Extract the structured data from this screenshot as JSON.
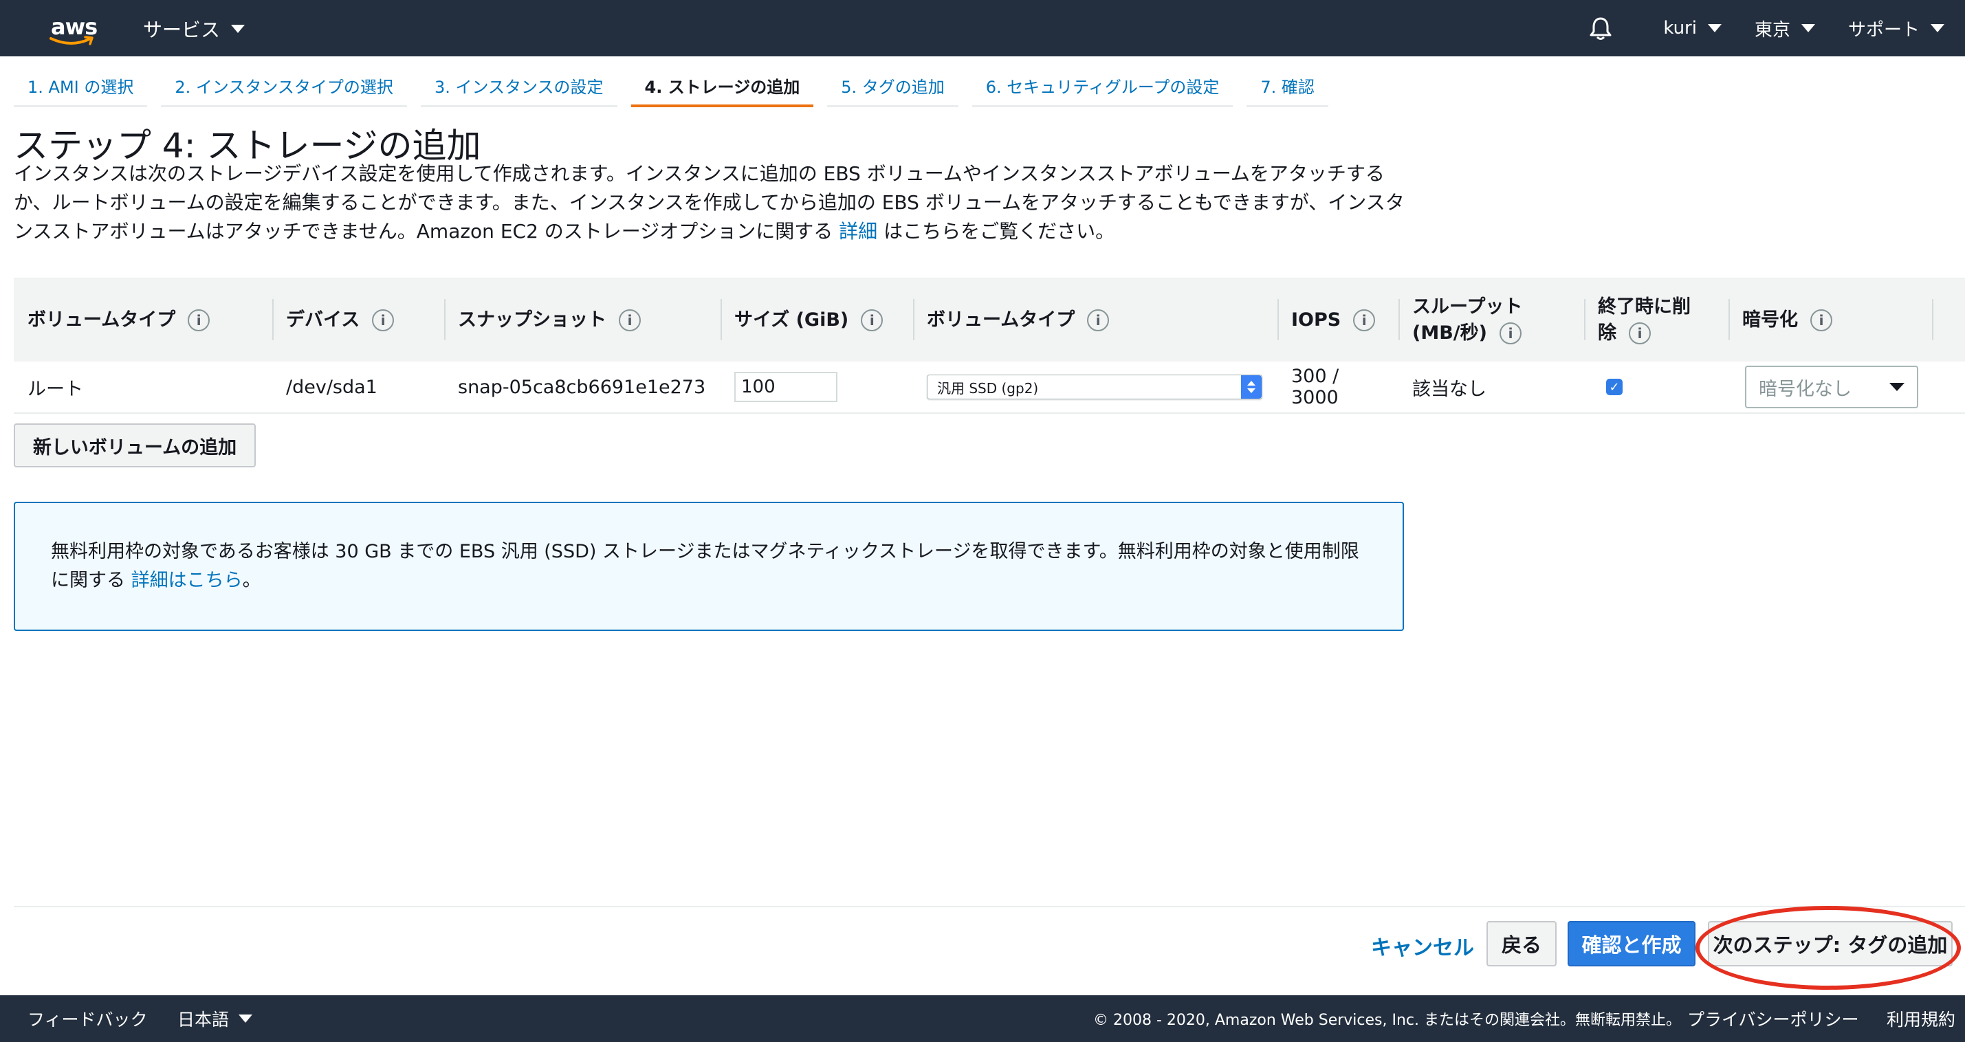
{
  "header": {
    "logo_text": "aws",
    "services_label": "サービス",
    "user_label": "kuri",
    "region_label": "東京",
    "support_label": "サポート"
  },
  "tabs": [
    {
      "label": "1. AMI の選択"
    },
    {
      "label": "2. インスタンスタイプの選択"
    },
    {
      "label": "3. インスタンスの設定"
    },
    {
      "label": "4. ストレージの追加"
    },
    {
      "label": "5. タグの追加"
    },
    {
      "label": "6. セキュリティグループの設定"
    },
    {
      "label": "7. 確認"
    }
  ],
  "page": {
    "title": "ステップ 4: ストレージの追加",
    "intro_text": "インスタンスは次のストレージデバイス設定を使用して作成されます。インスタンスに追加の EBS ボリュームやインスタンスストアボリュームをアタッチするか、ルートボリュームの設定を編集することができます。また、インスタンスを作成してから追加の EBS ボリュームをアタッチすることもできますが、インスタンスストアボリュームはアタッチできません。Amazon EC2 のストレージオプションに関する",
    "intro_link": "詳細",
    "intro_suffix": "はこちらをご覧ください。"
  },
  "table": {
    "headers": {
      "volume_type": "ボリュームタイプ",
      "device": "デバイス",
      "snapshot": "スナップショット",
      "size": "サイズ (GiB)",
      "ebs_type": "ボリュームタイプ",
      "iops": "IOPS",
      "throughput_line1": "スループット",
      "throughput_line2": "(MB/秒)",
      "delete_line1": "終了時に削",
      "delete_line2": "除",
      "encryption": "暗号化"
    },
    "rows": [
      {
        "volume_type": "ルート",
        "device": "/dev/sda1",
        "snapshot": "snap-05ca8cb6691e1e273",
        "size": "100",
        "ebs_type": "汎用 SSD (gp2)",
        "iops": "300 / 3000",
        "throughput": "該当なし",
        "delete_on_termination": "✓",
        "encryption": "暗号化なし"
      }
    ],
    "info_icon": "i"
  },
  "add_volume_label": "新しいボリュームの追加",
  "info_box": {
    "text": "無料利用枠の対象であるお客様は 30 GB までの EBS 汎用 (SSD) ストレージまたはマグネティックストレージを取得できます。無料利用枠の対象と使用制限に関する",
    "link": "詳細はこちら",
    "suffix": "。"
  },
  "actions": {
    "cancel": "キャンセル",
    "back": "戻る",
    "review_and_launch": "確認と作成",
    "next": "次のステップ: タグの追加"
  },
  "footer": {
    "feedback": "フィードバック",
    "language": "日本語",
    "copyright": "© 2008 - 2020, Amazon Web Services, Inc. またはその関連会社。無断転用禁止。",
    "privacy": "プライバシーポリシー",
    "terms": "利用規約"
  },
  "colors": {
    "nav_bg": "#232f3e",
    "link": "#0073bb",
    "active_tab": "#ec7211",
    "primary_button": "#2a7de1",
    "highlight_ring": "#e53020"
  }
}
